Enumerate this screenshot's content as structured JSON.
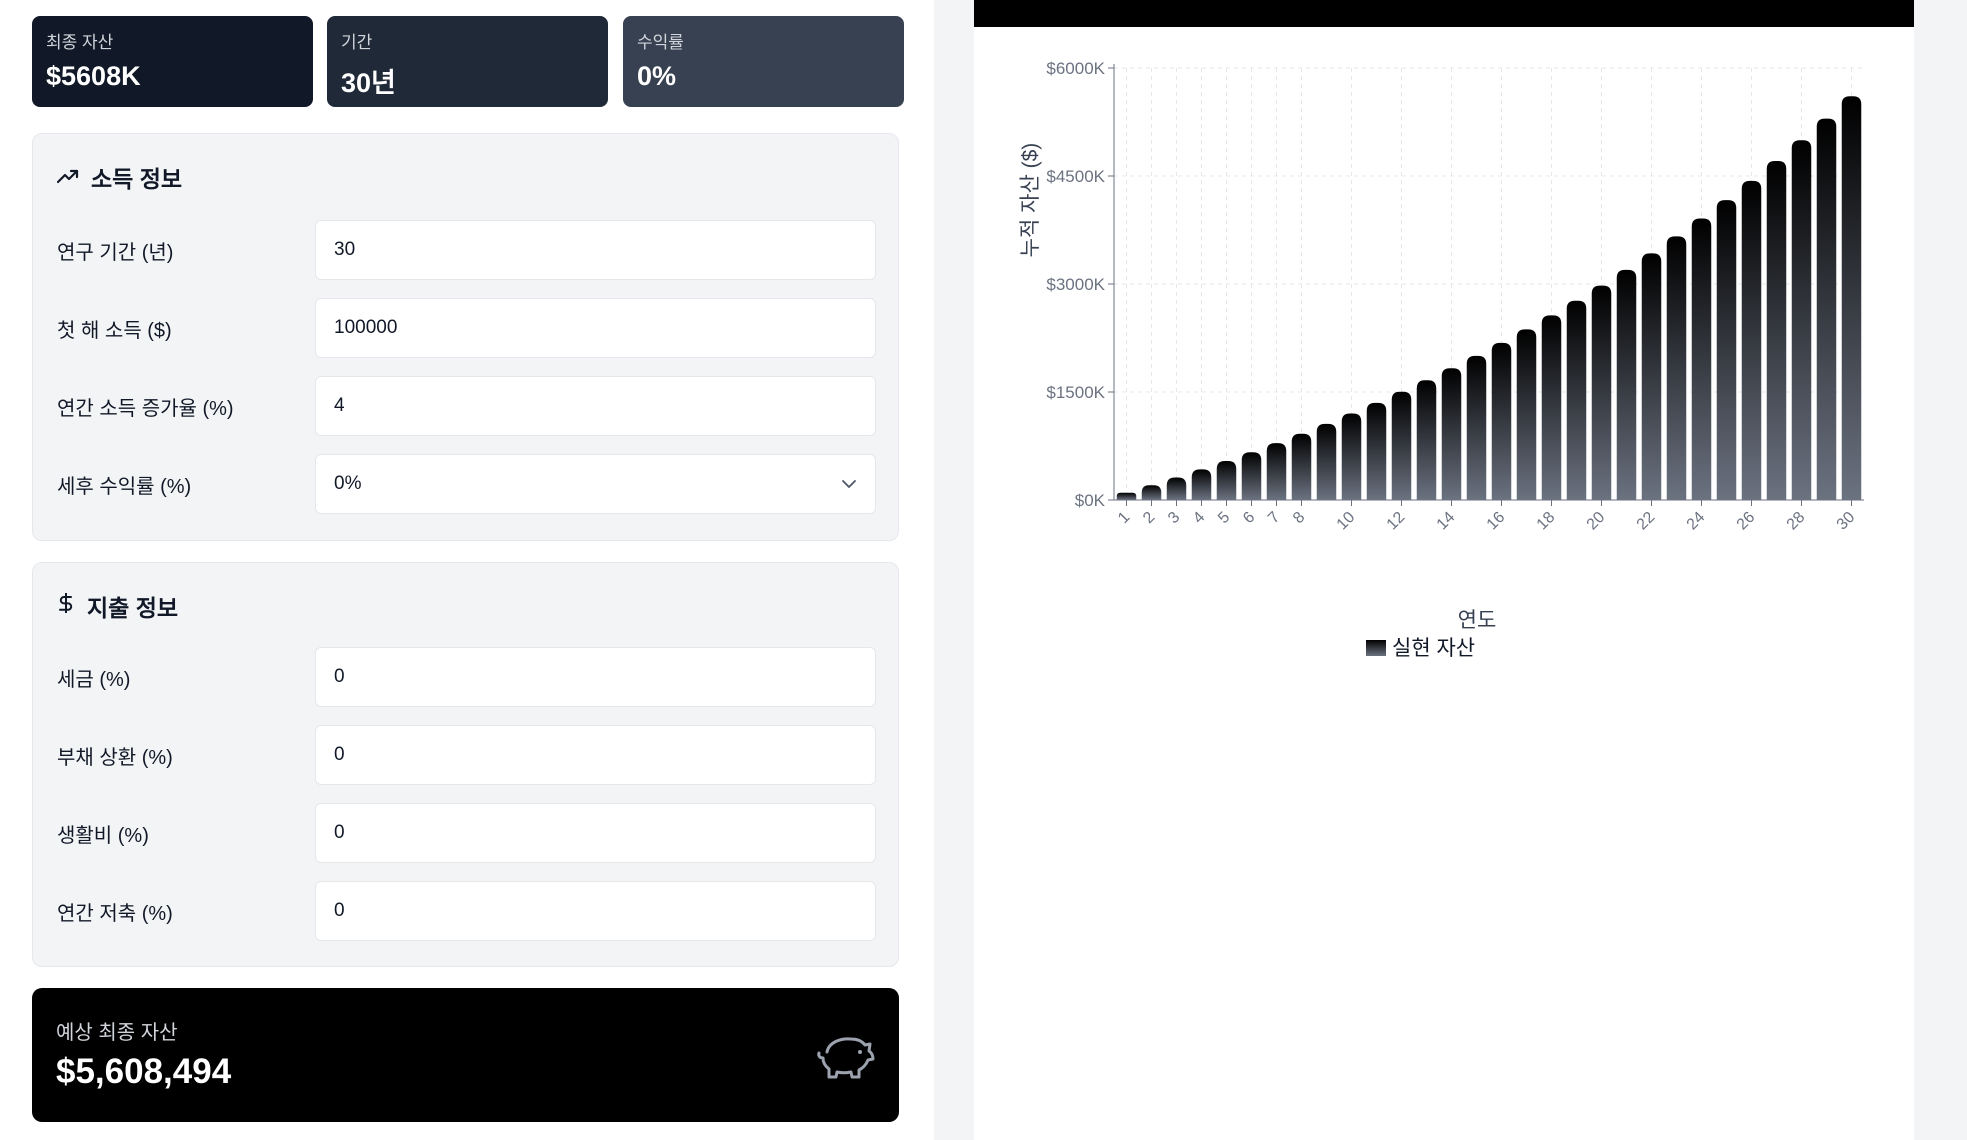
{
  "stats": [
    {
      "label": "최종 자산",
      "value": "$5608K"
    },
    {
      "label": "기간",
      "value": "30년"
    },
    {
      "label": "수익률",
      "value": "0%"
    }
  ],
  "income": {
    "title": "소득 정보",
    "fields": [
      {
        "label": "연구 기간 (년)",
        "value": "30"
      },
      {
        "label": "첫 해 소득 ($)",
        "value": "100000"
      },
      {
        "label": "연간 소득 증가율 (%)",
        "value": "4"
      },
      {
        "label": "세후 수익률 (%)",
        "value": "0%"
      }
    ]
  },
  "expense": {
    "title": "지출 정보",
    "fields": [
      {
        "label": "세금 (%)",
        "value": "0"
      },
      {
        "label": "부채 상환 (%)",
        "value": "0"
      },
      {
        "label": "생활비 (%)",
        "value": "0"
      },
      {
        "label": "연간 저축 (%)",
        "value": "0"
      }
    ]
  },
  "summary": {
    "label": "예상 최종 자산",
    "value": "$5,608,494"
  },
  "icons": {
    "income": "trending-up-icon",
    "expense": "dollar-icon",
    "select": "chevron-down-icon",
    "summary": "piggy-bank-icon"
  },
  "chart_data": {
    "type": "bar",
    "xlabel": "연도",
    "ylabel": "누적 자산 ($)",
    "ylim": [
      0,
      6000
    ],
    "yticks": [
      "$0K",
      "$1500K",
      "$3000K",
      "$4500K",
      "$6000K"
    ],
    "x_tick_labels": [
      "1",
      "2",
      "3",
      "4",
      "5",
      "6",
      "7",
      "8",
      "10",
      "12",
      "14",
      "16",
      "18",
      "20",
      "22",
      "24",
      "26",
      "28",
      "30"
    ],
    "categories": [
      1,
      2,
      3,
      4,
      5,
      6,
      7,
      8,
      9,
      10,
      11,
      12,
      13,
      14,
      15,
      16,
      17,
      18,
      19,
      20,
      21,
      22,
      23,
      24,
      25,
      26,
      27,
      28,
      29,
      30
    ],
    "series": [
      {
        "name": "실현 자산",
        "values": [
          100,
          204,
          312,
          425,
          542,
          663,
          790,
          921,
          1058,
          1201,
          1349,
          1503,
          1663,
          1829,
          2002,
          2182,
          2369,
          2564,
          2767,
          2978,
          3197,
          3425,
          3662,
          3909,
          4165,
          4432,
          4709,
          4997,
          5297,
          5608
        ]
      }
    ],
    "grid": true,
    "legend": "bottom-center",
    "bar_gradient": [
      "#000000",
      "#6b7280"
    ]
  }
}
